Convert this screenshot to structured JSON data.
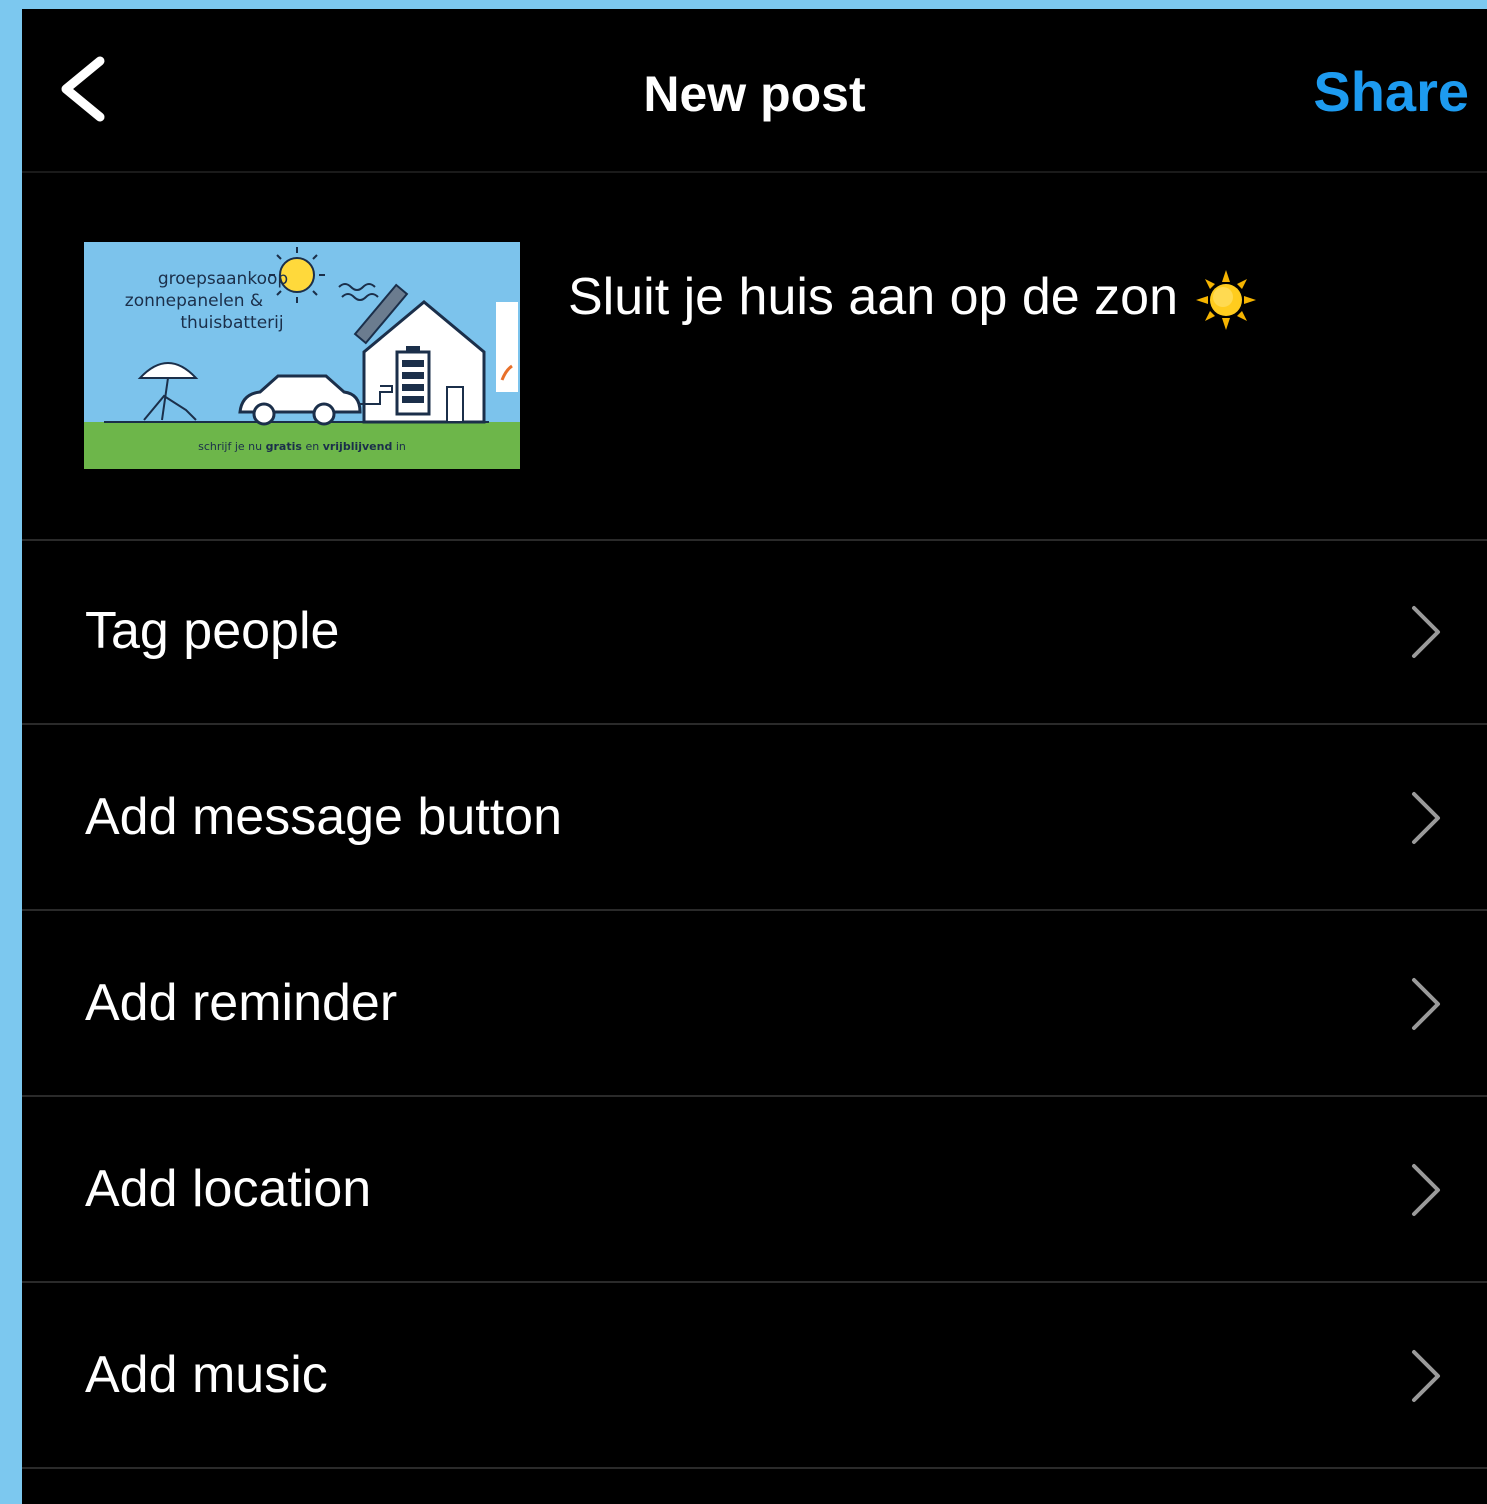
{
  "header": {
    "title": "New post",
    "share_label": "Share"
  },
  "post": {
    "caption": "Sluit je huis aan op de zon",
    "caption_emoji": "sun-emoji",
    "thumbnail": {
      "line1": "groepsaankoop",
      "line2": "zonnepanelen &",
      "line3": "thuisbatterij",
      "footer_prefix": "schrijf je nu",
      "footer_bold1": "gratis",
      "footer_mid": "en",
      "footer_bold2": "vrijblijvend",
      "footer_suffix": "in"
    }
  },
  "menu": [
    {
      "label": "Tag people"
    },
    {
      "label": "Add message button"
    },
    {
      "label": "Add reminder"
    },
    {
      "label": "Add location"
    },
    {
      "label": "Add music"
    }
  ],
  "colors": {
    "accent": "#1d9bf0",
    "background": "#000000",
    "frame": "#7cc8ef"
  }
}
